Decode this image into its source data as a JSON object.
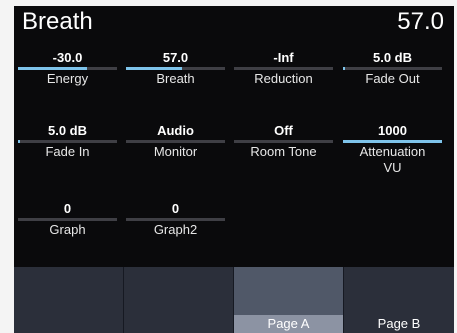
{
  "header": {
    "title": "Breath",
    "value": "57.0"
  },
  "params": [
    {
      "value": "-30.0",
      "name": "Energy",
      "level": 0.7
    },
    {
      "value": "57.0",
      "name": "Breath",
      "level": 0.57
    },
    {
      "value": "-Inf",
      "name": "Reduction",
      "level": 0.0
    },
    {
      "value": "5.0 dB",
      "name": "Fade Out",
      "level": 0.02
    },
    {
      "value": "5.0 dB",
      "name": "Fade In",
      "level": 0.02
    },
    {
      "value": "Audio",
      "name": "Monitor",
      "level": 0.0
    },
    {
      "value": "Off",
      "name": "Room Tone",
      "level": 0.0
    },
    {
      "value": "1000",
      "name": "Attenuation\nVU",
      "level": 1.0
    },
    {
      "value": "0",
      "name": "Graph",
      "level": 0.0
    },
    {
      "value": "0",
      "name": "Graph2",
      "level": 0.0
    }
  ],
  "softkeys": [
    {
      "label": "",
      "active": false
    },
    {
      "label": "",
      "active": false
    },
    {
      "label": "Page A",
      "active": true
    },
    {
      "label": "Page B",
      "active": false
    }
  ],
  "colors": {
    "accent": "#7ec3ea",
    "track": "#3f3f45",
    "softkey_bg": "#2b2f3a",
    "softkey_active": "#8c93a3"
  }
}
